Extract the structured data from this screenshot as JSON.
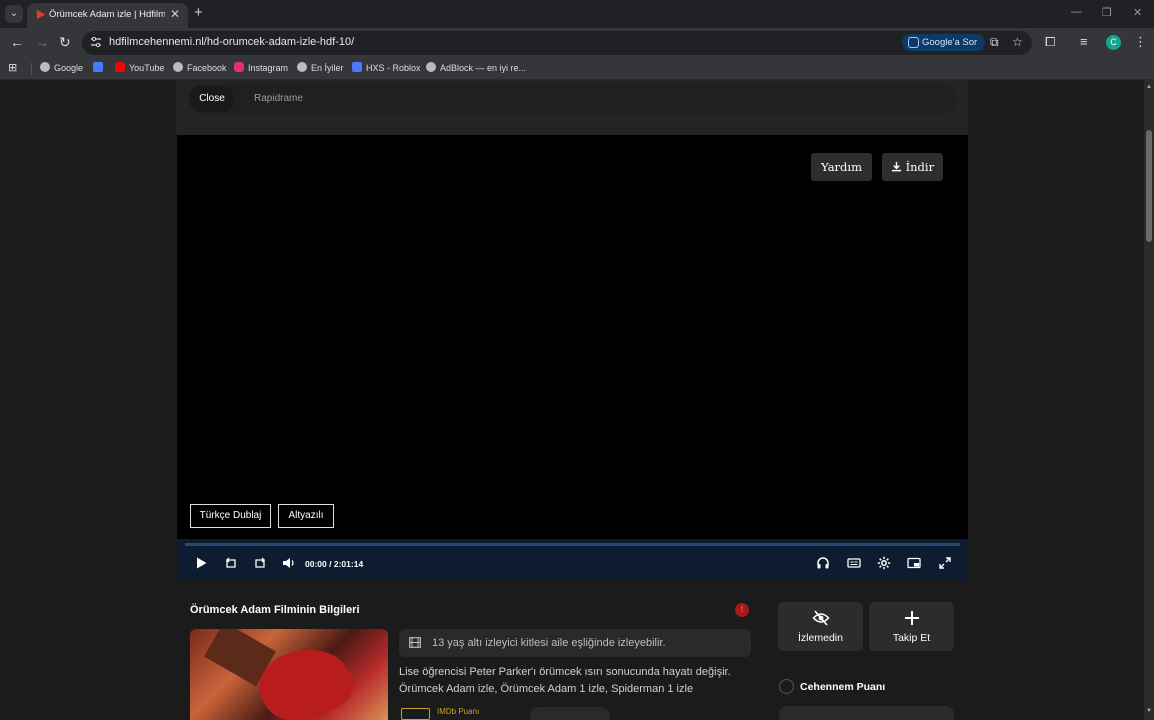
{
  "browser": {
    "tab_title": "Örümcek Adam izle | Hdfilmcehennemi",
    "url": "hdfilmcehennemi.nl/hd-orumcek-adam-izle-hdf-10/",
    "google_sor_label": "Google'a Sor",
    "profile_initial": "C",
    "bookmarks": [
      {
        "label": "Google",
        "icon": "globe-icon",
        "color": "#bbbbbb"
      },
      {
        "label": "",
        "icon": "roblox-icon",
        "color": "#4a78ff"
      },
      {
        "label": "YouTube",
        "icon": "youtube-icon",
        "color": "#ff0000"
      },
      {
        "label": "Facebook",
        "icon": "globe-icon",
        "color": "#bbbbbb"
      },
      {
        "label": "Instagram",
        "icon": "instagram-icon",
        "color": "#e1306c"
      },
      {
        "label": "En İyiler",
        "icon": "globe-icon",
        "color": "#bbbbbb"
      },
      {
        "label": "HXS - Roblox",
        "icon": "roblox-icon",
        "color": "#4a78ff"
      },
      {
        "label": "AdBlock — en iyi re...",
        "icon": "globe-icon",
        "color": "#bbbbbb"
      }
    ]
  },
  "sources": {
    "active": "Close",
    "other": "Rapidrame"
  },
  "player": {
    "help_label": "Yardım",
    "download_label": "İndir",
    "dub_label": "Türkçe Dublaj",
    "sub_label": "Altyazılı",
    "current_time": "00:00",
    "separator": "/",
    "duration": "2:01:14",
    "progress_fraction": 0.0
  },
  "info": {
    "title": "Örümcek Adam Filminin Bilgileri",
    "age_note": "13 yaş altı izleyici kitlesi aile eşliğinde izleyebilir.",
    "description": "Lise öğrencisi Peter Parker'ı örümcek ısırı sonucunda hayatı değişir. Örümcek Adam izle, Örümcek Adam 1 izle, Spiderman 1 izle",
    "imdb_label": "IMDb Puanı"
  },
  "sidebar": {
    "not_watched_label": "İzlemedin",
    "follow_label": "Takip Et",
    "score_title": "Cehennem Puanı"
  },
  "colors": {
    "page_bg": "#1b1b1b",
    "control_bar": "#0d1c30",
    "progress": "#6c9fd6",
    "imdb_gold": "#c9a227",
    "accent_red": "#a71a1a"
  }
}
